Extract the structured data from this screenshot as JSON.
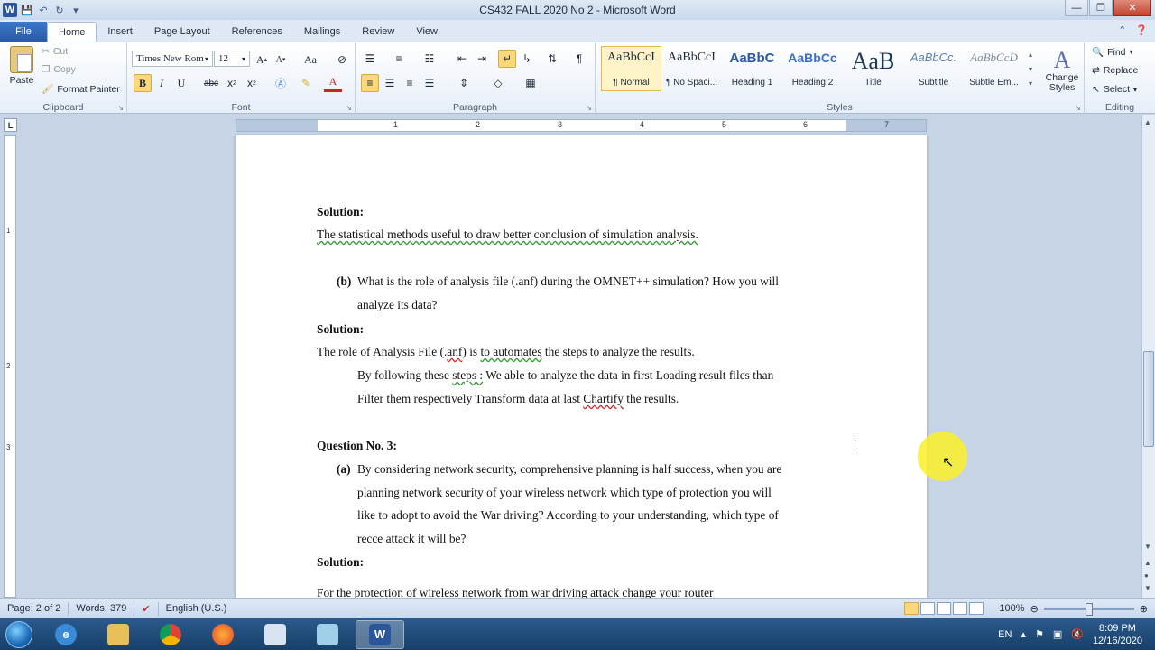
{
  "window": {
    "title": "CS432 FALL 2020 No 2 - Microsoft Word",
    "app_letter": "W"
  },
  "tabs": [
    "File",
    "Home",
    "Insert",
    "Page Layout",
    "References",
    "Mailings",
    "Review",
    "View"
  ],
  "clipboard": {
    "paste": "Paste",
    "cut": "Cut",
    "copy": "Copy",
    "format_painter": "Format Painter",
    "label": "Clipboard"
  },
  "font": {
    "name": "Times New Rom",
    "size": "12",
    "grow": "A",
    "shrink": "A",
    "change_case": "Aa",
    "bold": "B",
    "italic": "I",
    "underline": "U",
    "strike": "abc",
    "subscript": "x",
    "superscript": "x",
    "font_color": "A",
    "label": "Font"
  },
  "paragraph": {
    "pilcrow": "¶",
    "label": "Paragraph"
  },
  "styles": {
    "label": "Styles",
    "items": [
      {
        "preview": "AaBbCcI",
        "name": "¶ Normal"
      },
      {
        "preview": "AaBbCcI",
        "name": "¶ No Spaci..."
      },
      {
        "preview": "AaBbC",
        "name": "Heading 1"
      },
      {
        "preview": "AaBbCc",
        "name": "Heading 2"
      },
      {
        "preview": "AaB",
        "name": "Title"
      },
      {
        "preview": "AaBbCc.",
        "name": "Subtitle"
      },
      {
        "preview": "AaBbCcD",
        "name": "Subtle Em..."
      }
    ],
    "change_styles": "Change Styles",
    "change_letter": "A"
  },
  "editing": {
    "find": "Find",
    "replace": "Replace",
    "select": "Select",
    "label": "Editing"
  },
  "ruler": {
    "h_numbers": [
      "1",
      "2",
      "3",
      "4",
      "5",
      "6",
      "7"
    ],
    "v_numbers": [
      "1",
      "2",
      "3"
    ],
    "tab_stop": "L"
  },
  "document": {
    "solution1_label": "Solution",
    "solution1_text": "The statistical methods useful to draw better conclusion of simulation analysis.",
    "qb_marker": "(b)",
    "qb_line1": "What is the role of analysis file (.anf) during the OMNET++ simulation? How you will",
    "qb_line2": "analyze its data?",
    "solution2_label": "Solution",
    "sol2_a": "The role of Analysis File (.",
    "sol2_b": "anf",
    "sol2_c": ") is ",
    "sol2_d": "to  automates",
    "sol2_e": " the steps to analyze the results.",
    "sol2_line2_a": "By following these ",
    "sol2_line2_b": "steps :",
    "sol2_line2_c": " We able to analyze the data  in first Loading result files  than",
    "sol2_line3_a": "Filter them respectively Transform  data at last ",
    "sol2_line3_b": "Chartify",
    "sol2_line3_c": " the results.",
    "q3_label": "Question No. 3:",
    "qa_marker": "(a)",
    "qa_line1": "By considering network security, comprehensive planning is half success, when you are",
    "qa_line2": "planning network security of your wireless network which type of protection you will",
    "qa_line3": "like to adopt to avoid the War driving? According to your understanding, which type of",
    "qa_line4": "recce attack it will be?",
    "solution3_label": "Solution",
    "sol3_text": "For the protection of wireless network from war driving attack  change your router",
    "colon": ":"
  },
  "status": {
    "page": "Page: 2 of 2",
    "words": "Words: 379",
    "language": "English (U.S.)",
    "zoom": "100%"
  },
  "taskbar": {
    "lang": "EN",
    "time": "8:09 PM",
    "date": "12/16/2020"
  },
  "colors": {
    "word_blue": "#2b579a",
    "file_tab": "#2a5aa8",
    "highlight_yellow": "#faf028"
  }
}
